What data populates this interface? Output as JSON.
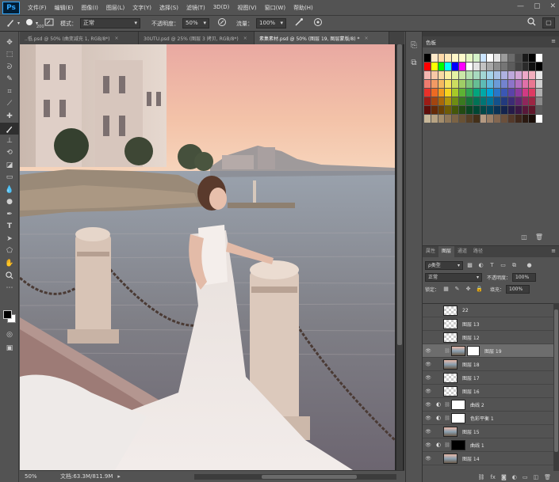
{
  "app": {
    "logo": "Ps"
  },
  "menu": [
    "文件(F)",
    "编辑(E)",
    "图像(I)",
    "图层(L)",
    "文字(Y)",
    "选择(S)",
    "滤镜(T)",
    "3D(D)",
    "视图(V)",
    "窗口(W)",
    "帮助(H)"
  ],
  "window_controls": [
    "—",
    "▢",
    "✕"
  ],
  "options": {
    "brush_size": "200",
    "mode_label": "模式：",
    "mode_value": "正常",
    "opacity_label": "不透明度：",
    "opacity_value": "50%",
    "flow_label": "流量：",
    "flow_value": "100%"
  },
  "tabs": [
    {
      "label": "..低.psd @ 50% (曲变减充 1, RGB/8*)",
      "close": "×"
    },
    {
      "label": "30UTU.psd @ 25% (图层 3 拷贝, RGB/8*)",
      "close": "×"
    },
    {
      "label": "素集素材.psd @ 50% (图层 19, 图层蒙版/8) *",
      "close": "×"
    }
  ],
  "status": {
    "zoom": "50%",
    "doc": "文档:63.3M/811.9M",
    "arrow": "▸"
  },
  "panels": {
    "swatches": {
      "title": "色板"
    },
    "layer_tabs": [
      "属性",
      "图层",
      "通道",
      "路径"
    ],
    "filter_kind": "ρ类型",
    "blend_mode": "正常",
    "opacity_label": "不透明度：",
    "opacity_value": "100%",
    "lock_label": "锁定：",
    "fill_label": "填充：",
    "fill_value": "100%"
  },
  "layers": [
    {
      "name": "22",
      "visible": false,
      "thumb": "checker",
      "selected": false
    },
    {
      "name": "图层 13",
      "visible": false,
      "thumb": "checker",
      "selected": false
    },
    {
      "name": "图层 12",
      "visible": false,
      "thumb": "checker",
      "selected": false
    },
    {
      "name": "图层 19",
      "visible": true,
      "thumb": "photo",
      "mask": true,
      "selected": true
    },
    {
      "name": "图层 18",
      "visible": true,
      "thumb": "photo",
      "selected": false
    },
    {
      "name": "图层 17",
      "visible": true,
      "thumb": "checker",
      "selected": false
    },
    {
      "name": "图层 16",
      "visible": true,
      "thumb": "checker",
      "selected": false
    },
    {
      "name": "曲线 2",
      "visible": true,
      "thumb": "white",
      "adjustment": true,
      "selected": false
    },
    {
      "name": "色彩平衡 1",
      "visible": true,
      "thumb": "white",
      "adjustment": true,
      "selected": false
    },
    {
      "name": "图层 15",
      "visible": true,
      "thumb": "photo",
      "selected": false
    },
    {
      "name": "曲线 1",
      "visible": true,
      "thumb": "black",
      "adjustment": true,
      "selected": false
    },
    {
      "name": "图层 14",
      "visible": true,
      "thumb": "photo",
      "selected": false
    }
  ],
  "colors": {
    "accent": "#31a8ff",
    "swatch_rows": [
      [
        "#000000",
        "#ffe9c9",
        "#ffd9a8",
        "#ffe8b8",
        "#fff7c8",
        "#fffacb",
        "#e5f6c2",
        "#d5f2c9",
        "#cbe5ff",
        "#ffffff",
        "#e4e4e4",
        "#9b9b9b",
        "#6b6b6b",
        "#4a4a4a",
        "#1a1a1a",
        "#000000",
        "#ffffff"
      ],
      [
        "#ff0000",
        "#ffff00",
        "#00ff00",
        "#00ffff",
        "#0000ff",
        "#ff00ff",
        "#ffffff",
        "#e4e4e4",
        "#c2c2c2",
        "#a8a8a8",
        "#8e8e8e",
        "#757575",
        "#5c5c5c",
        "#434343",
        "#2a2a2a",
        "#0f0f0f",
        "#000000"
      ],
      [
        "#f4b6b0",
        "#f7c8a6",
        "#f9d9a3",
        "#fbf0a3",
        "#e4f1a4",
        "#cbe6a8",
        "#b5dfb1",
        "#a7d9bf",
        "#a2d6d5",
        "#a5d3ea",
        "#a9c2e6",
        "#aeb1e0",
        "#bea8dc",
        "#d4a7d6",
        "#eea8c8",
        "#f1aebc",
        "#e8e8e8"
      ],
      [
        "#ee7c6f",
        "#f29a64",
        "#f5b95f",
        "#f8e25f",
        "#ccdd60",
        "#9fcd66",
        "#7ec47a",
        "#66be94",
        "#5dbcb6",
        "#5fb7dc",
        "#6b9bd8",
        "#7383cf",
        "#8d74c9",
        "#b270c1",
        "#e070a8",
        "#e97791",
        "#d0d0d0"
      ],
      [
        "#e8312a",
        "#ed6a22",
        "#f19a1e",
        "#f6d31e",
        "#a6c928",
        "#5db234",
        "#2ea553",
        "#00a57d",
        "#00a8a8",
        "#00a3d8",
        "#2976c8",
        "#3a57b4",
        "#5b43a8",
        "#8b3ba0",
        "#d13a84",
        "#de3a62",
        "#b0b0b0"
      ],
      [
        "#9c1c16",
        "#a3450f",
        "#a9670a",
        "#af940b",
        "#6e8c13",
        "#3a7920",
        "#177239",
        "#007356",
        "#007575",
        "#007296",
        "#13518b",
        "#223a7e",
        "#3c2c75",
        "#5f2670",
        "#8f265c",
        "#9c2643",
        "#8a8a8a"
      ],
      [
        "#5f0e0a",
        "#652a07",
        "#6a4005",
        "#6f5c06",
        "#445709",
        "#224a13",
        "#0b4622",
        "#004734",
        "#004848",
        "#00465d",
        "#0a3256",
        "#14244e",
        "#251b48",
        "#3b1745",
        "#581739",
        "#60172a",
        "#5c5c5c"
      ],
      [
        "#c8b89a",
        "#b7a383",
        "#a38d6c",
        "#8f7758",
        "#7b6345",
        "#685134",
        "#563f26",
        "#443019",
        "#b59a82",
        "#9c8068",
        "#836751",
        "#6b503c",
        "#54392a",
        "#3f271b",
        "#2b1911",
        "#1a0e08",
        "#ffffff"
      ]
    ]
  }
}
